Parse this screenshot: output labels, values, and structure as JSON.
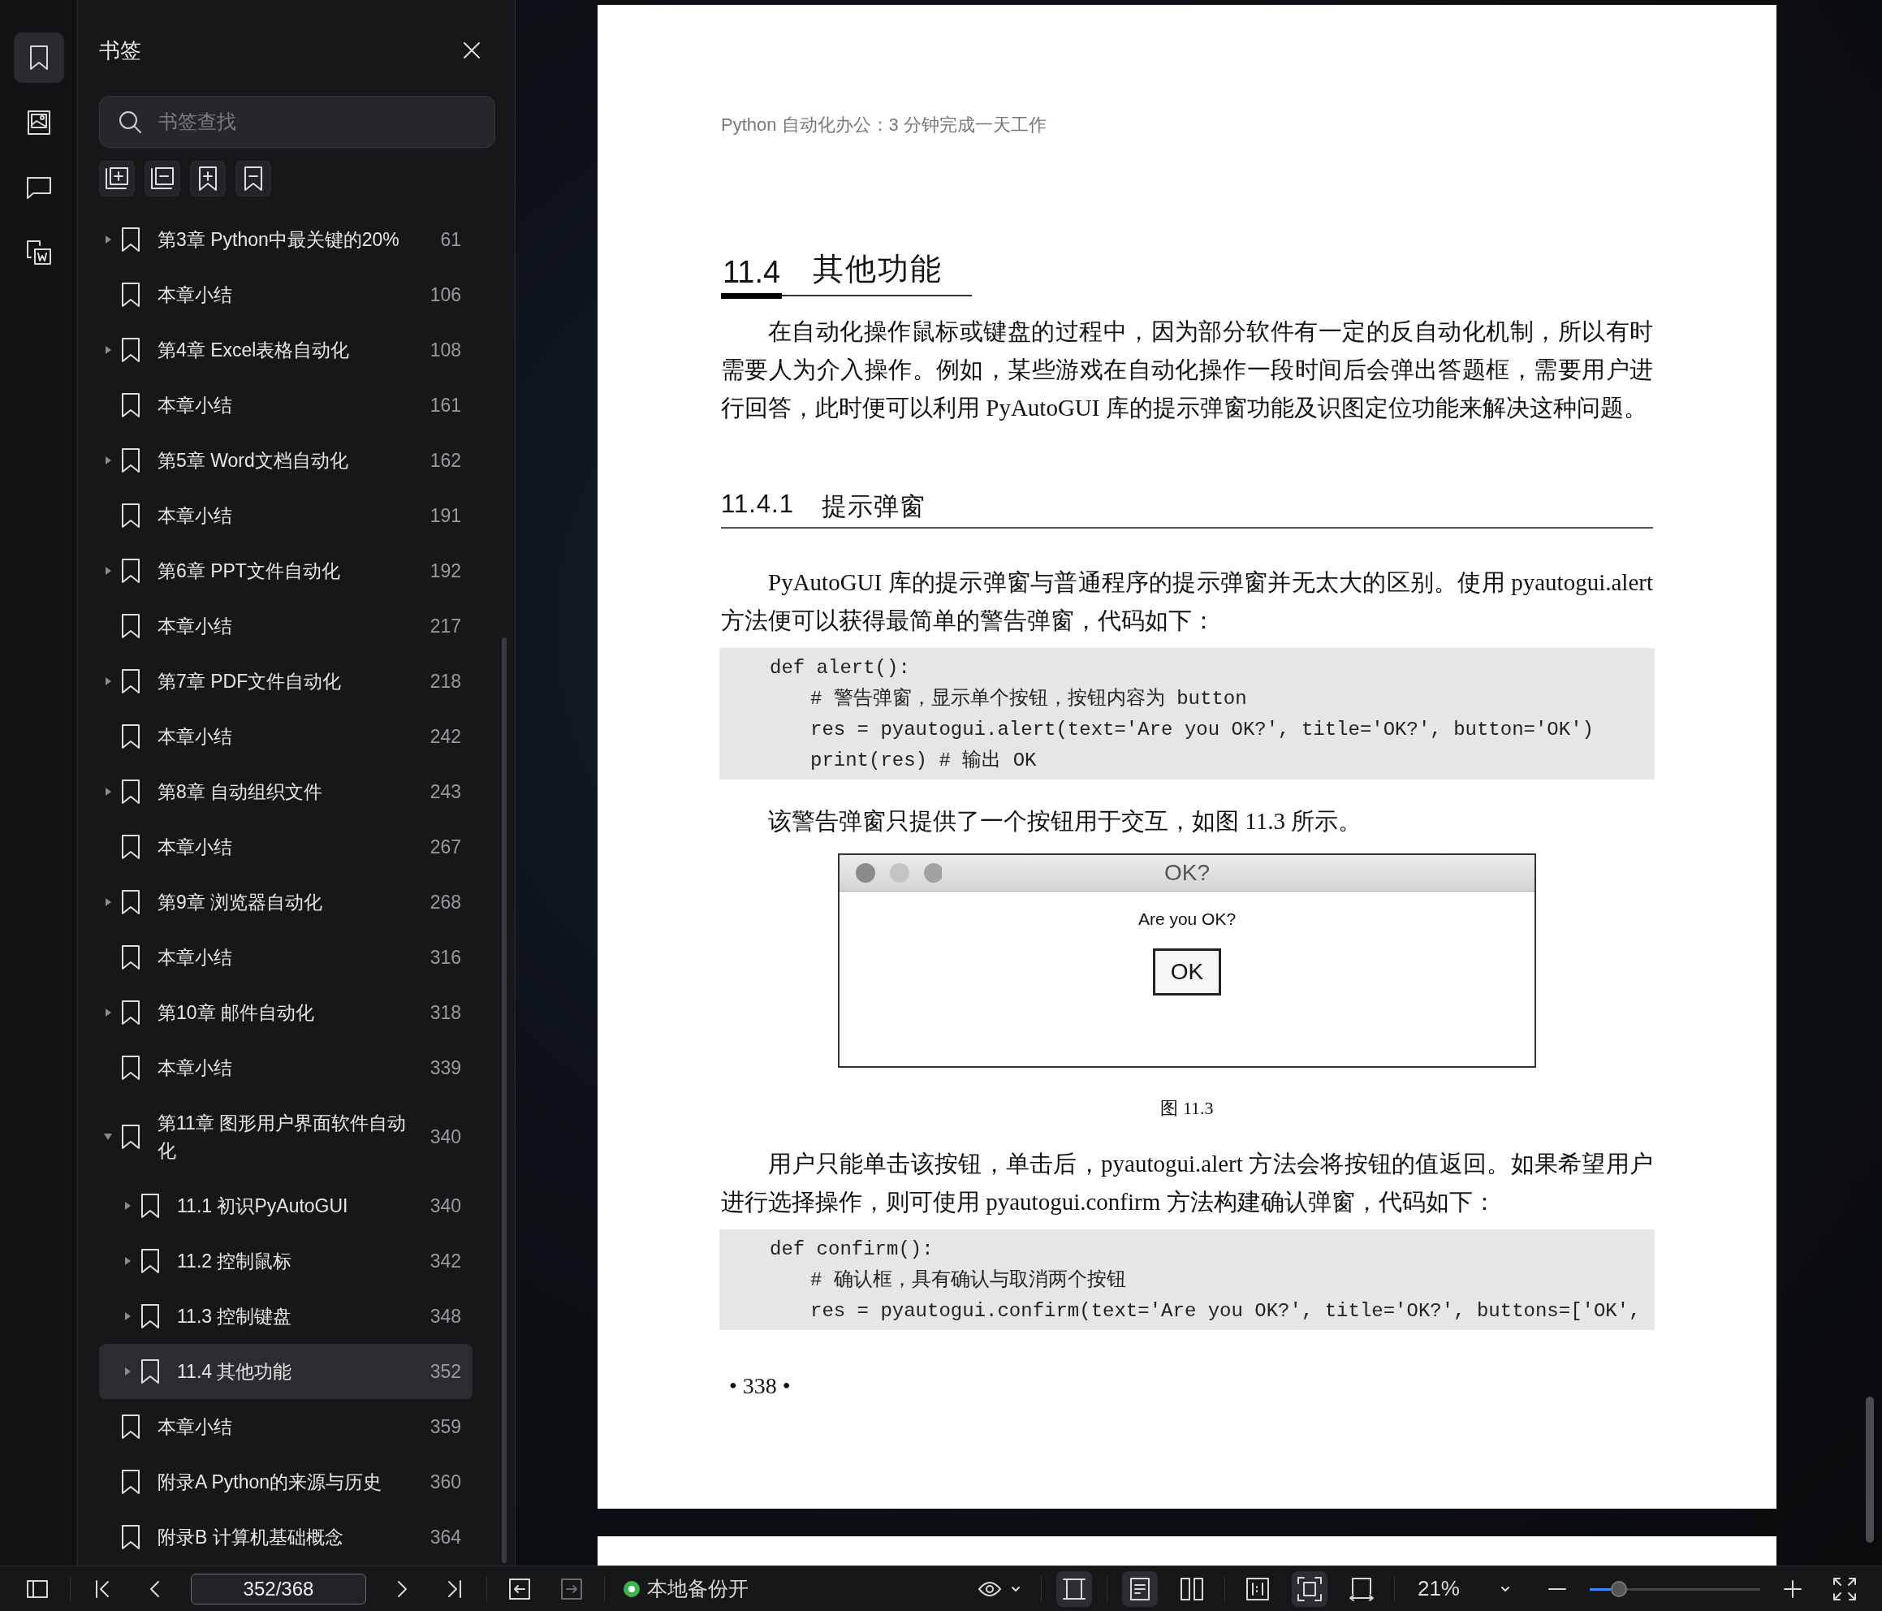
{
  "rail": [
    {
      "kind": "bookmark",
      "selected": true
    },
    {
      "kind": "image",
      "selected": false
    },
    {
      "kind": "comment",
      "selected": false
    },
    {
      "kind": "convert",
      "selected": false
    }
  ],
  "panel": {
    "title": "书签",
    "search": {
      "placeholder": "书签查找"
    },
    "tools": [
      {
        "kind": "expand-all"
      },
      {
        "kind": "collapse-all"
      },
      {
        "kind": "add"
      },
      {
        "kind": "remove"
      }
    ],
    "bookmarks": [
      {
        "title": "第3章 Python中最关键的20%",
        "page": "61",
        "expanded": false,
        "selected": false
      },
      {
        "title": "本章小结",
        "page": "106",
        "selected": false
      },
      {
        "title": "第4章 Excel表格自动化",
        "page": "108",
        "expanded": false,
        "selected": false
      },
      {
        "title": "本章小结",
        "page": "161",
        "selected": false
      },
      {
        "title": "第5章 Word文档自动化",
        "page": "162",
        "expanded": false,
        "selected": false
      },
      {
        "title": "本章小结",
        "page": "191",
        "selected": false
      },
      {
        "title": "第6章 PPT文件自动化",
        "page": "192",
        "expanded": false,
        "selected": false
      },
      {
        "title": "本章小结",
        "page": "217",
        "selected": false
      },
      {
        "title": "第7章 PDF文件自动化",
        "page": "218",
        "expanded": false,
        "selected": false
      },
      {
        "title": "本章小结",
        "page": "242",
        "selected": false
      },
      {
        "title": "第8章 自动组织文件",
        "page": "243",
        "expanded": false,
        "selected": false
      },
      {
        "title": "本章小结",
        "page": "267",
        "selected": false
      },
      {
        "title": "第9章 浏览器自动化",
        "page": "268",
        "expanded": false,
        "selected": false
      },
      {
        "title": "本章小结",
        "page": "316",
        "selected": false
      },
      {
        "title": "第10章 邮件自动化",
        "page": "318",
        "expanded": false,
        "selected": false
      },
      {
        "title": "本章小结",
        "page": "339",
        "selected": false
      },
      {
        "title": "第11章 图形用户界面软件自动化",
        "page": "340",
        "expanded": true,
        "selected": false,
        "children": [
          {
            "title": "11.1 初识PyAutoGUI",
            "page": "340",
            "expanded": false,
            "selected": false
          },
          {
            "title": "11.2 控制鼠标",
            "page": "342",
            "expanded": false,
            "selected": false
          },
          {
            "title": "11.3 控制键盘",
            "page": "348",
            "expanded": false,
            "selected": false
          },
          {
            "title": "11.4 其他功能",
            "page": "352",
            "expanded": false,
            "selected": true
          }
        ]
      },
      {
        "title": "本章小结",
        "page": "359",
        "selected": false
      },
      {
        "title": "附录A Python的来源与历史",
        "page": "360",
        "selected": false
      },
      {
        "title": "附录B 计算机基础概念",
        "page": "364",
        "selected": false
      }
    ]
  },
  "page": {
    "running_header": "Python 自动化办公：3 分钟完成一天工作",
    "section": {
      "number": "11.4",
      "title": "其他功能"
    },
    "blocks": [
      {
        "kind": "para",
        "text": "在自动化操作鼠标或键盘的过程中，因为部分软件有一定的反自动化机制，所以有时需要人为介入操作。例如，某些游戏在自动化操作一段时间后会弹出答题框，需要用户进行回答，此时便可以利用 PyAutoGUI 库的提示弹窗功能及识图定位功能来解决这种问题。"
      },
      {
        "kind": "subsection",
        "number": "11.4.1",
        "title": "提示弹窗"
      },
      {
        "kind": "para",
        "text": "PyAutoGUI 库的提示弹窗与普通程序的提示弹窗并无太大的区别。使用 pyautogui.alert 方法便可以获得最简单的警告弹窗，代码如下："
      },
      {
        "kind": "code",
        "lines": [
          {
            "text": "def alert():",
            "children": [
              {
                "text": "# 警告弹窗，显示单个按钮，按钮内容为 button"
              },
              {
                "text": "res = pyautogui.alert(text='Are you OK?', title='OK?', button='OK')"
              },
              {
                "text": "print(res) # 输出 OK"
              }
            ]
          }
        ]
      },
      {
        "kind": "para",
        "text": "该警告弹窗只提供了一个按钮用于交互，如图 11.3 所示。"
      },
      {
        "kind": "figure",
        "dialog": {
          "title": "OK?",
          "message": "Are you OK?",
          "button": "OK"
        },
        "caption": "图 11.3"
      },
      {
        "kind": "para",
        "text": "用户只能单击该按钮，单击后，pyautogui.alert 方法会将按钮的值返回。如果希望用户进行选择操作，则可使用 pyautogui.confirm 方法构建确认弹窗，代码如下："
      },
      {
        "kind": "code",
        "lines": [
          {
            "text": "def confirm():",
            "children": [
              {
                "text": "# 确认框，具有确认与取消两个按钮"
              },
              {
                "text": "res = pyautogui.confirm(text='Are you OK?', title='OK?', buttons=['OK',"
              }
            ]
          }
        ]
      }
    ],
    "page_number": "• 338 •"
  },
  "toolbar": {
    "nav": [
      {
        "kind": "first",
        "disabled": false
      },
      {
        "kind": "prev",
        "disabled": false
      }
    ],
    "page_field": {
      "value": "352/368"
    },
    "nav_after": [
      {
        "kind": "next",
        "disabled": false
      },
      {
        "kind": "last",
        "disabled": false
      }
    ],
    "history": [
      {
        "kind": "back",
        "disabled": false
      },
      {
        "kind": "forward",
        "disabled": true
      }
    ],
    "backup": {
      "label": "本地备份开",
      "on": true
    },
    "scroll_mode": [
      {
        "kind": "continuous",
        "selected": true
      }
    ],
    "page_mode": [
      {
        "kind": "single",
        "selected": true
      },
      {
        "kind": "double",
        "selected": false
      }
    ],
    "fit_mode": [
      {
        "kind": "fit-width",
        "selected": false
      },
      {
        "kind": "fit-page",
        "selected": true
      },
      {
        "kind": "actual-size",
        "selected": false
      }
    ],
    "zoom": {
      "value": "21%",
      "level": 0.17
    }
  }
}
